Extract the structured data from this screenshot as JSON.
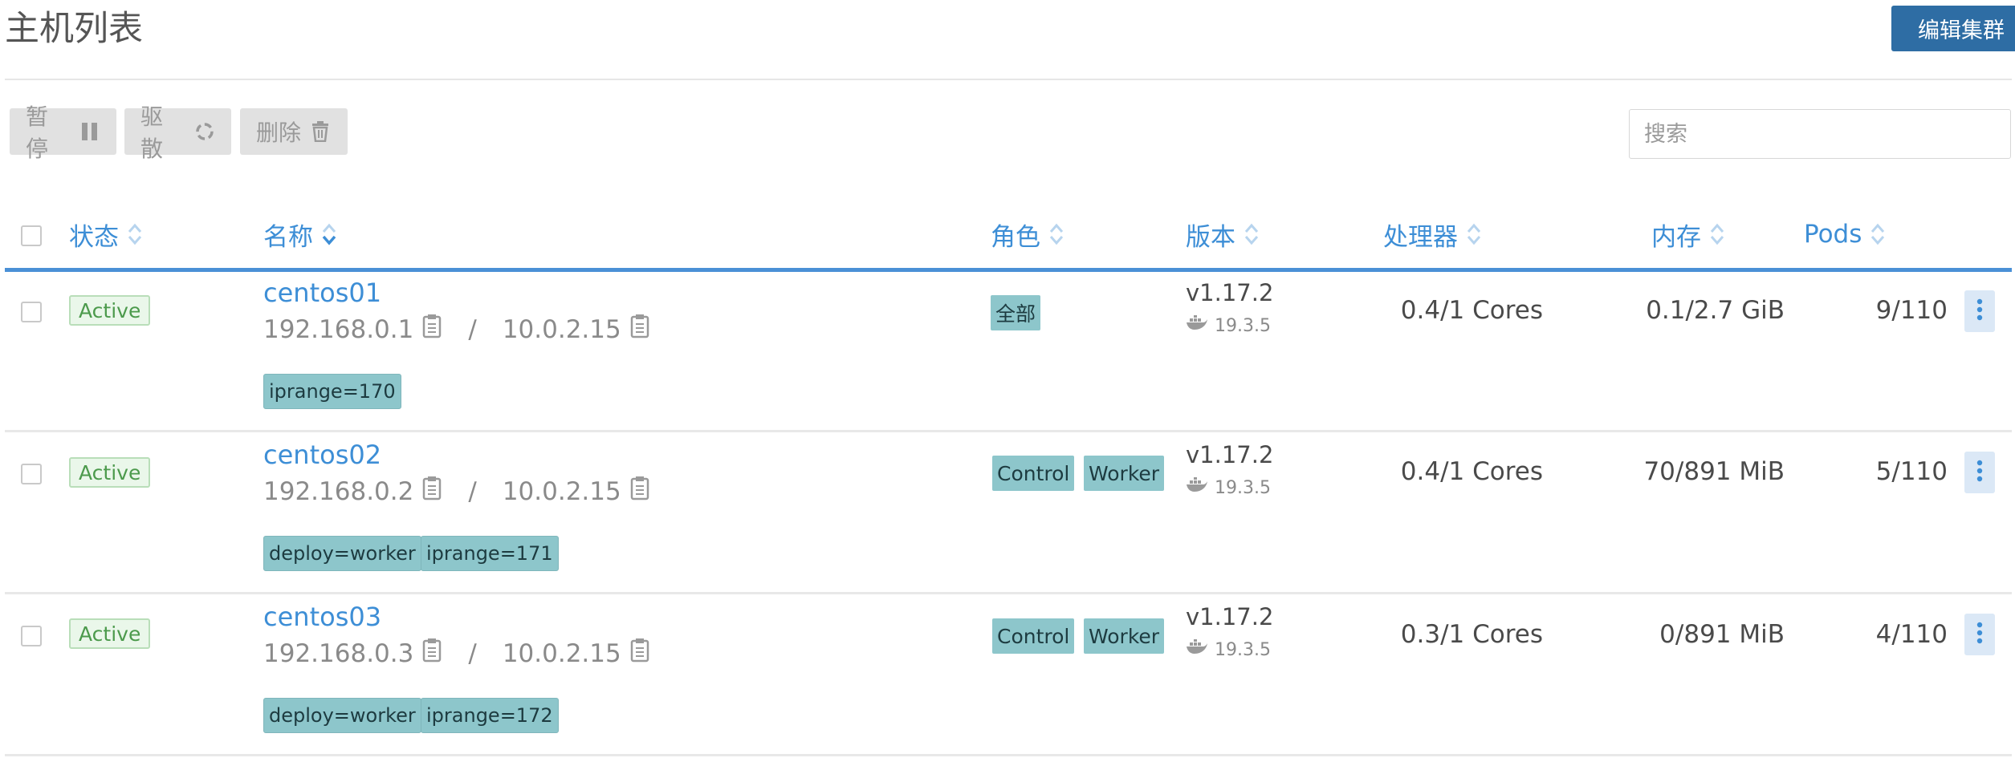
{
  "page": {
    "title": "主机列表",
    "edit_cluster_label": "编辑集群"
  },
  "toolbar": {
    "pause_label": "暂停",
    "drain_label": "驱散",
    "delete_label": "删除"
  },
  "search": {
    "placeholder": "搜索",
    "value": ""
  },
  "columns": {
    "state": "状态",
    "name": "名称",
    "roles": "角色",
    "version": "版本",
    "cpu": "处理器",
    "memory": "内存",
    "pods": "Pods"
  },
  "colors": {
    "accent": "#3d8ed6",
    "primary_button": "#2e6da4",
    "tag": "#8dc6cb",
    "active": "#4c9a4c"
  },
  "rows": [
    {
      "state": "Active",
      "name": "centos01",
      "ip": "192.168.0.1",
      "internal_ip": "10.0.2.15",
      "ip_separator": "/",
      "labels": [
        "iprange=170"
      ],
      "roles": [
        "全部"
      ],
      "version": "v1.17.2",
      "docker_version": "19.3.5",
      "cpu": "0.4/1 Cores",
      "memory": "0.1/2.7 GiB",
      "pods": "9/110"
    },
    {
      "state": "Active",
      "name": "centos02",
      "ip": "192.168.0.2",
      "internal_ip": "10.0.2.15",
      "ip_separator": "/",
      "labels": [
        "deploy=worker",
        "iprange=171"
      ],
      "roles": [
        "Control",
        "Worker"
      ],
      "version": "v1.17.2",
      "docker_version": "19.3.5",
      "cpu": "0.4/1 Cores",
      "memory": "70/891 MiB",
      "pods": "5/110"
    },
    {
      "state": "Active",
      "name": "centos03",
      "ip": "192.168.0.3",
      "internal_ip": "10.0.2.15",
      "ip_separator": "/",
      "labels": [
        "deploy=worker",
        "iprange=172"
      ],
      "roles": [
        "Control",
        "Worker"
      ],
      "version": "v1.17.2",
      "docker_version": "19.3.5",
      "cpu": "0.3/1 Cores",
      "memory": "0/891 MiB",
      "pods": "4/110"
    }
  ]
}
